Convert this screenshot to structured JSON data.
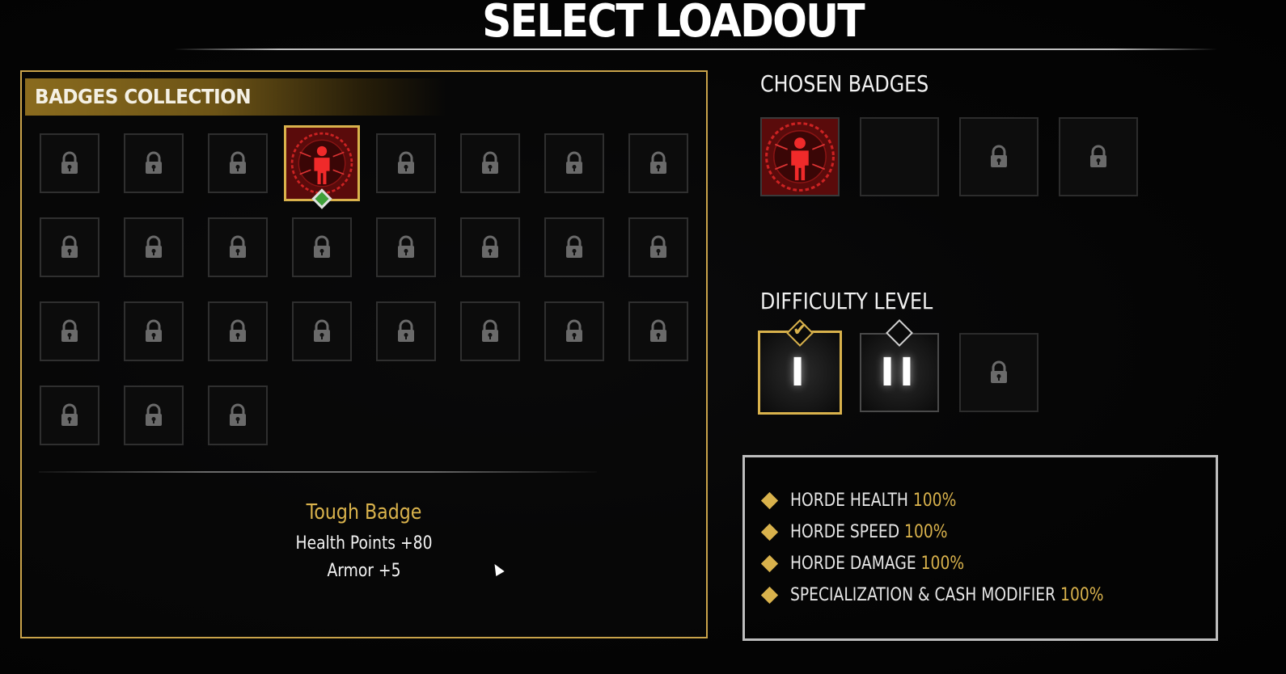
{
  "title": "SELECT LOADOUT",
  "badges_collection": {
    "header": "BADGES COLLECTION",
    "rows": [
      [
        "locked",
        "locked",
        "locked",
        "tough",
        "locked",
        "locked",
        "locked",
        "locked"
      ],
      [
        "locked",
        "locked",
        "locked",
        "locked",
        "locked",
        "locked",
        "locked",
        "locked"
      ],
      [
        "locked",
        "locked",
        "locked",
        "locked",
        "locked",
        "locked",
        "locked",
        "locked"
      ],
      [
        "locked",
        "locked",
        "locked"
      ]
    ],
    "selected_badge": {
      "name": "Tough Badge",
      "stats": [
        "Health Points +80",
        "Armor +5"
      ]
    }
  },
  "chosen_badges": {
    "header": "CHOSEN BADGES",
    "slots": [
      "tough",
      "empty",
      "locked",
      "locked"
    ]
  },
  "difficulty": {
    "header": "DIFFICULTY LEVEL",
    "levels": [
      {
        "label": "I",
        "state": "selected"
      },
      {
        "label": "II",
        "state": "available"
      },
      {
        "label": "",
        "state": "locked"
      }
    ]
  },
  "modifiers": [
    {
      "label": "HORDE HEALTH",
      "value": "100%"
    },
    {
      "label": "HORDE SPEED",
      "value": "100%"
    },
    {
      "label": "HORDE DAMAGE",
      "value": "100%"
    },
    {
      "label": "SPECIALIZATION & CASH MODIFIER",
      "value": "100%"
    }
  ],
  "colors": {
    "accent_gold": "#d9b24c",
    "badge_red": "#5a0b0b",
    "selected_diamond_green": "#3fa03a"
  },
  "icons": {
    "locked": "padlock-icon",
    "tough": "tough-badge-icon"
  }
}
